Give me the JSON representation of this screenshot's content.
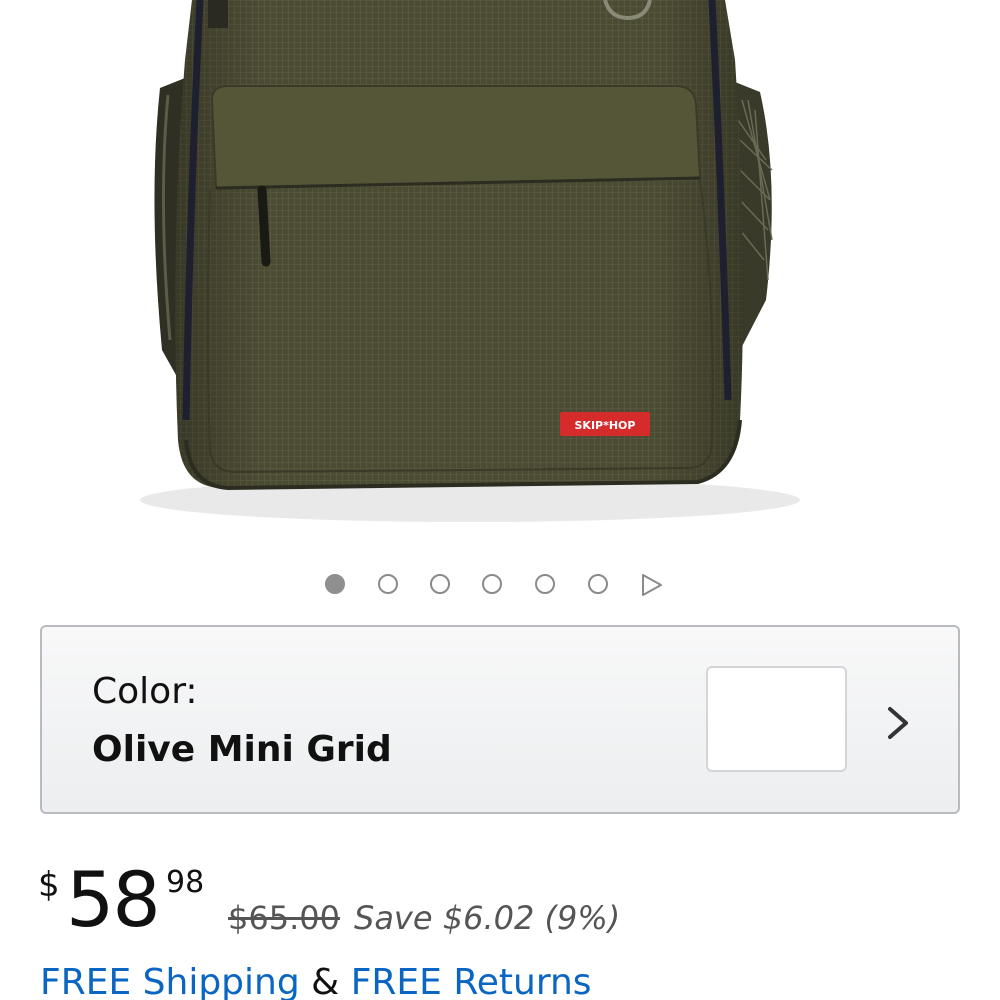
{
  "product": {
    "image": {
      "alt": "Olive backpack with front zip pocket and side mesh pockets",
      "logo_text": "SKIP*HOP",
      "bag_color": "#4a4a33",
      "logo_color": "#d62b2b"
    }
  },
  "carousel": {
    "total_dots": 6,
    "active_index": 0,
    "next_icon": "play-triangle-icon"
  },
  "color_selector": {
    "label": "Color:",
    "value": "Olive Mini Grid",
    "chevron_icon": "chevron-right-icon"
  },
  "price": {
    "currency": "$",
    "whole": "58",
    "fraction": "98",
    "list_price": "$65.00",
    "savings": "Save $6.02 (9%)"
  },
  "shipping": {
    "free_shipping": "FREE Shipping",
    "ampersand": "&",
    "free_returns": "FREE Returns",
    "link_color": "#0a66c2"
  }
}
